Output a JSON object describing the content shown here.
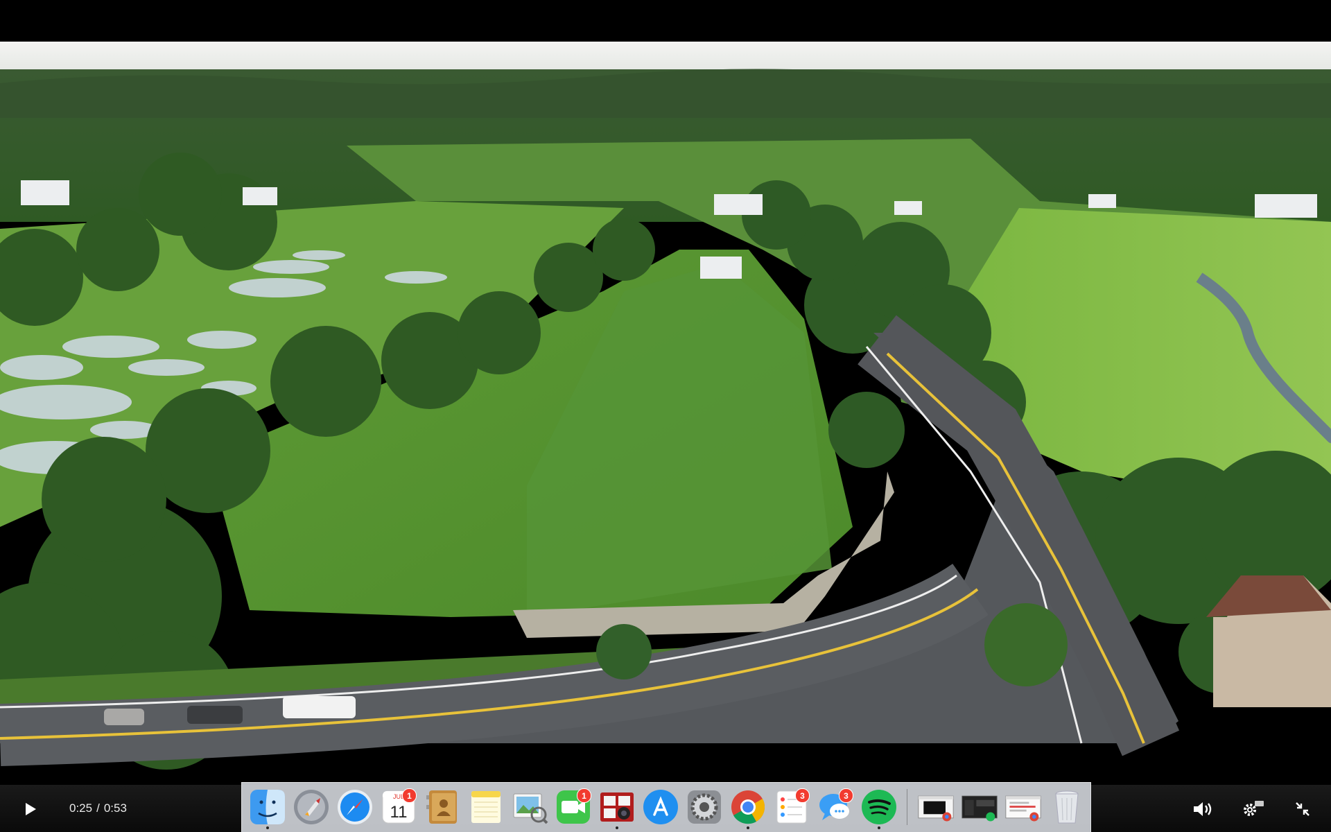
{
  "player": {
    "current_time": "0:25",
    "separator": "/",
    "duration": "0:53"
  },
  "dock": {
    "apps": [
      {
        "id": "finder",
        "icon": "finder-icon",
        "running": true
      },
      {
        "id": "launchpad",
        "icon": "launchpad-icon",
        "running": false
      },
      {
        "id": "safari",
        "icon": "safari-icon",
        "running": false
      },
      {
        "id": "calendar",
        "icon": "calendar-icon",
        "month": "JUL",
        "day": "11",
        "badge": "1",
        "running": false
      },
      {
        "id": "contacts",
        "icon": "contacts-icon",
        "running": false
      },
      {
        "id": "notes",
        "icon": "notes-icon",
        "running": false
      },
      {
        "id": "preview",
        "icon": "preview-icon",
        "running": false
      },
      {
        "id": "facetime",
        "icon": "facetime-icon",
        "badge": "1",
        "running": false
      },
      {
        "id": "photo-booth",
        "icon": "photo-booth-icon",
        "running": true
      },
      {
        "id": "app-store",
        "icon": "app-store-icon",
        "running": false
      },
      {
        "id": "system-preferences",
        "icon": "gear-icon",
        "running": false
      },
      {
        "id": "chrome",
        "icon": "chrome-icon",
        "running": true
      },
      {
        "id": "reminders",
        "icon": "reminders-icon",
        "badge": "3",
        "running": false
      },
      {
        "id": "messages",
        "icon": "messages-icon",
        "badge": "3",
        "running": false
      },
      {
        "id": "spotify",
        "icon": "spotify-icon",
        "running": true
      }
    ],
    "minimized": [
      {
        "id": "minimized-chrome-video",
        "icon": "chrome-window-thumbnail-icon"
      },
      {
        "id": "minimized-spotify-window",
        "icon": "spotify-window-thumbnail-icon"
      },
      {
        "id": "minimized-chrome-window",
        "icon": "chrome-window-thumbnail-icon"
      }
    ],
    "trash": {
      "icon": "trash-icon"
    }
  },
  "colors": {
    "badge": "#f23b2f",
    "dock_bg": "#cdd0d6",
    "control_bar": "#111111"
  }
}
